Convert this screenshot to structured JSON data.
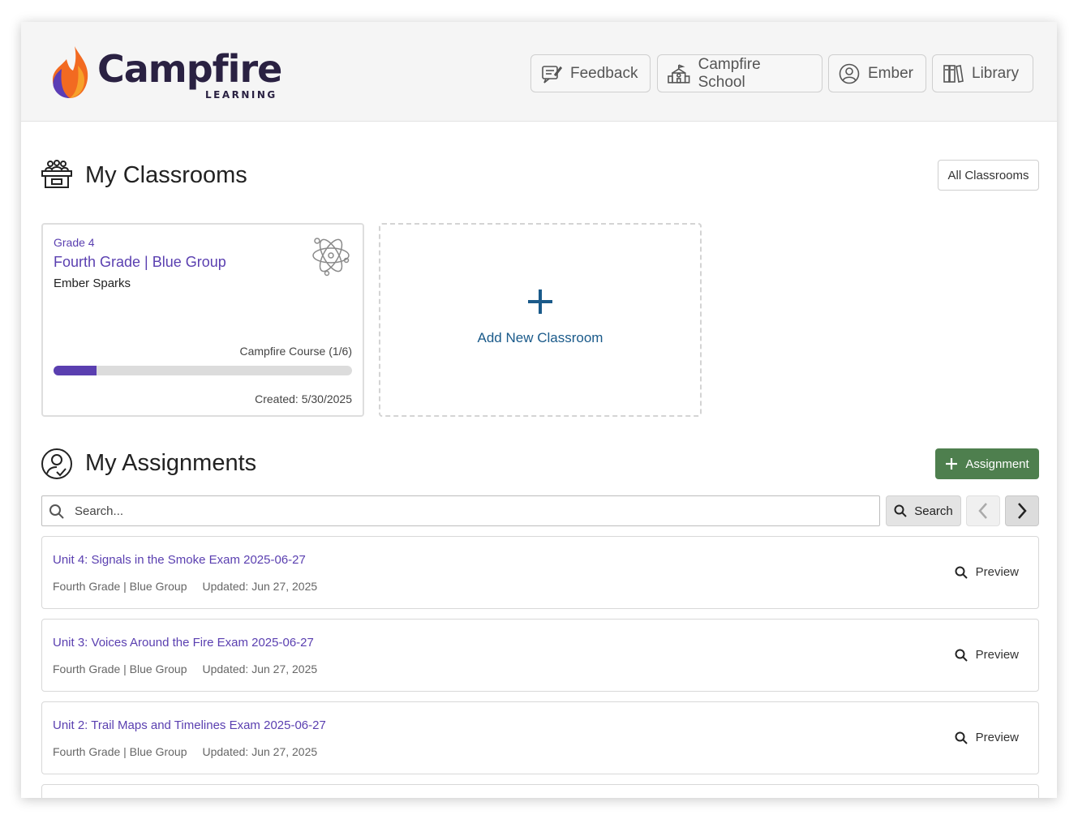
{
  "header": {
    "logo": {
      "word": "Campfire",
      "subtitle": "LEARNING"
    },
    "nav": [
      {
        "label": "Feedback",
        "icon": "feedback-icon"
      },
      {
        "label": "Campfire School",
        "icon": "school-icon"
      },
      {
        "label": "Ember",
        "icon": "user-icon"
      },
      {
        "label": "Library",
        "icon": "library-icon"
      }
    ]
  },
  "classrooms": {
    "title": "My Classrooms",
    "icon": "classroom-icon",
    "all_button": "All Classrooms",
    "cards": [
      {
        "grade": "Grade 4",
        "name": "Fourth Grade | Blue Group",
        "teacher": "Ember Sparks",
        "course": "Campfire Course  (1/6)",
        "progress": 0.145,
        "created": "Created: 5/30/2025",
        "icon": "atom-icon"
      }
    ],
    "add_label": "Add New Classroom"
  },
  "assignments": {
    "title": "My Assignments",
    "icon": "assignment-person-icon",
    "add_button": "Assignment",
    "search_placeholder": "Search...",
    "search_button": "Search",
    "items": [
      {
        "title": "Unit 4: Signals in the Smoke Exam 2025-06-27",
        "group": "Fourth Grade | Blue Group",
        "updated": "Updated: Jun 27, 2025",
        "action": "Preview"
      },
      {
        "title": "Unit 3: Voices Around the Fire Exam 2025-06-27",
        "group": "Fourth Grade | Blue Group",
        "updated": "Updated: Jun 27, 2025",
        "action": "Preview"
      },
      {
        "title": "Unit 2: Trail Maps and Timelines Exam 2025-06-27",
        "group": "Fourth Grade | Blue Group",
        "updated": "Updated: Jun 27, 2025",
        "action": "Preview"
      }
    ]
  },
  "colors": {
    "accent_purple": "#5a3fb0",
    "link_blue": "#1a5a8a",
    "green": "#4e7f4e",
    "flame_orange": "#f26a21",
    "flame_purple": "#5b3db5"
  }
}
